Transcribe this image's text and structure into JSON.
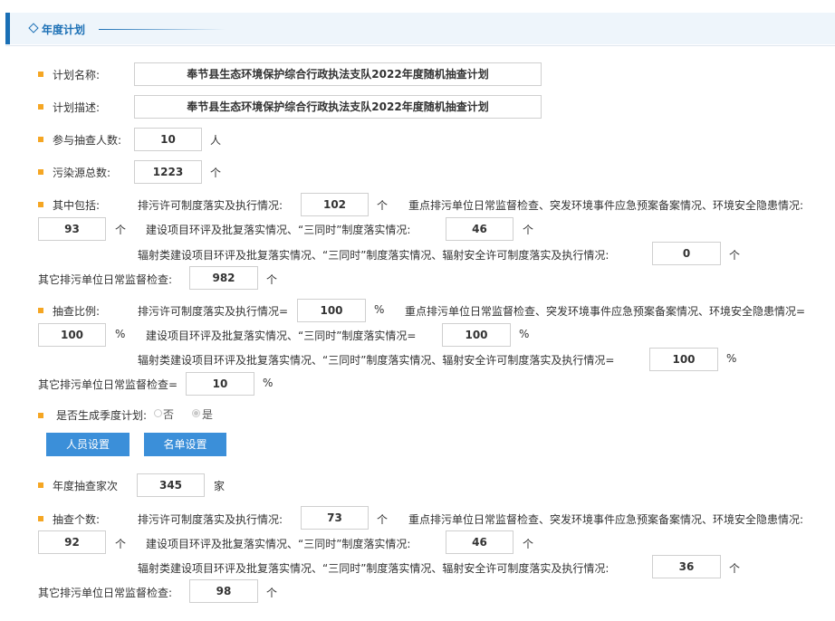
{
  "header": {
    "title": "年度计划"
  },
  "plan": {
    "name_label": "计划名称:",
    "name_value": "奉节县生态环境保护综合行政执法支队2022年度随机抽查计划",
    "desc_label": "计划描述:",
    "desc_value": "奉节县生态环境保护综合行政执法支队2022年度随机抽查计划",
    "people_label": "参与抽查人数:",
    "people_value": "10",
    "people_unit": "人",
    "sources_label": "污染源总数:",
    "sources_value": "1223",
    "sources_unit": "个"
  },
  "include": {
    "label": "其中包括:",
    "permit_label": "排污许可制度落实及执行情况:",
    "permit_value": "102",
    "key_label": "重点排污单位日常监督检查、突发环境事件应急预案备案情况、环境安全隐患情况:",
    "key_value": "93",
    "construct_label": "建设项目环评及批复落实情况、“三同时”制度落实情况:",
    "construct_value": "46",
    "radiation_label": "辐射类建设项目环评及批复落实情况、“三同时”制度落实情况、辐射安全许可制度落实及执行情况:",
    "radiation_value": "0",
    "other_label": "其它排污单位日常监督检查:",
    "other_value": "982",
    "unit": "个"
  },
  "ratio": {
    "label": "抽查比例:",
    "permit_label": "排污许可制度落实及执行情况=",
    "permit_value": "100",
    "key_label": "重点排污单位日常监督检查、突发环境事件应急预案备案情况、环境安全隐患情况=",
    "key_value": "100",
    "construct_label": "建设项目环评及批复落实情况、“三同时”制度落实情况=",
    "construct_value": "100",
    "radiation_label": "辐射类建设项目环评及批复落实情况、“三同时”制度落实情况、辐射安全许可制度落实及执行情况=",
    "radiation_value": "100",
    "other_label": "其它排污单位日常监督检查=",
    "other_value": "10",
    "unit": "%"
  },
  "seasonal": {
    "label": "是否生成季度计划:",
    "options": [
      "否",
      "是"
    ],
    "selected": "是"
  },
  "buttons": {
    "people": "人员设置",
    "list": "名单设置"
  },
  "annual": {
    "label": "年度抽查家次",
    "value": "345",
    "unit": "家"
  },
  "count": {
    "label": "抽查个数:",
    "permit_label": "排污许可制度落实及执行情况:",
    "permit_value": "73",
    "key_label": "重点排污单位日常监督检查、突发环境事件应急预案备案情况、环境安全隐患情况:",
    "key_value": "92",
    "construct_label": "建设项目环评及批复落实情况、“三同时”制度落实情况:",
    "construct_value": "46",
    "radiation_label": "辐射类建设项目环评及批复落实情况、“三同时”制度落实情况、辐射安全许可制度落实及执行情况:",
    "radiation_value": "36",
    "other_label": "其它排污单位日常监督检查:",
    "other_value": "98",
    "unit": "个"
  },
  "colors": {
    "accent": "#1a6fb5",
    "bullet": "#f5a623",
    "button": "#3b8fd9"
  }
}
